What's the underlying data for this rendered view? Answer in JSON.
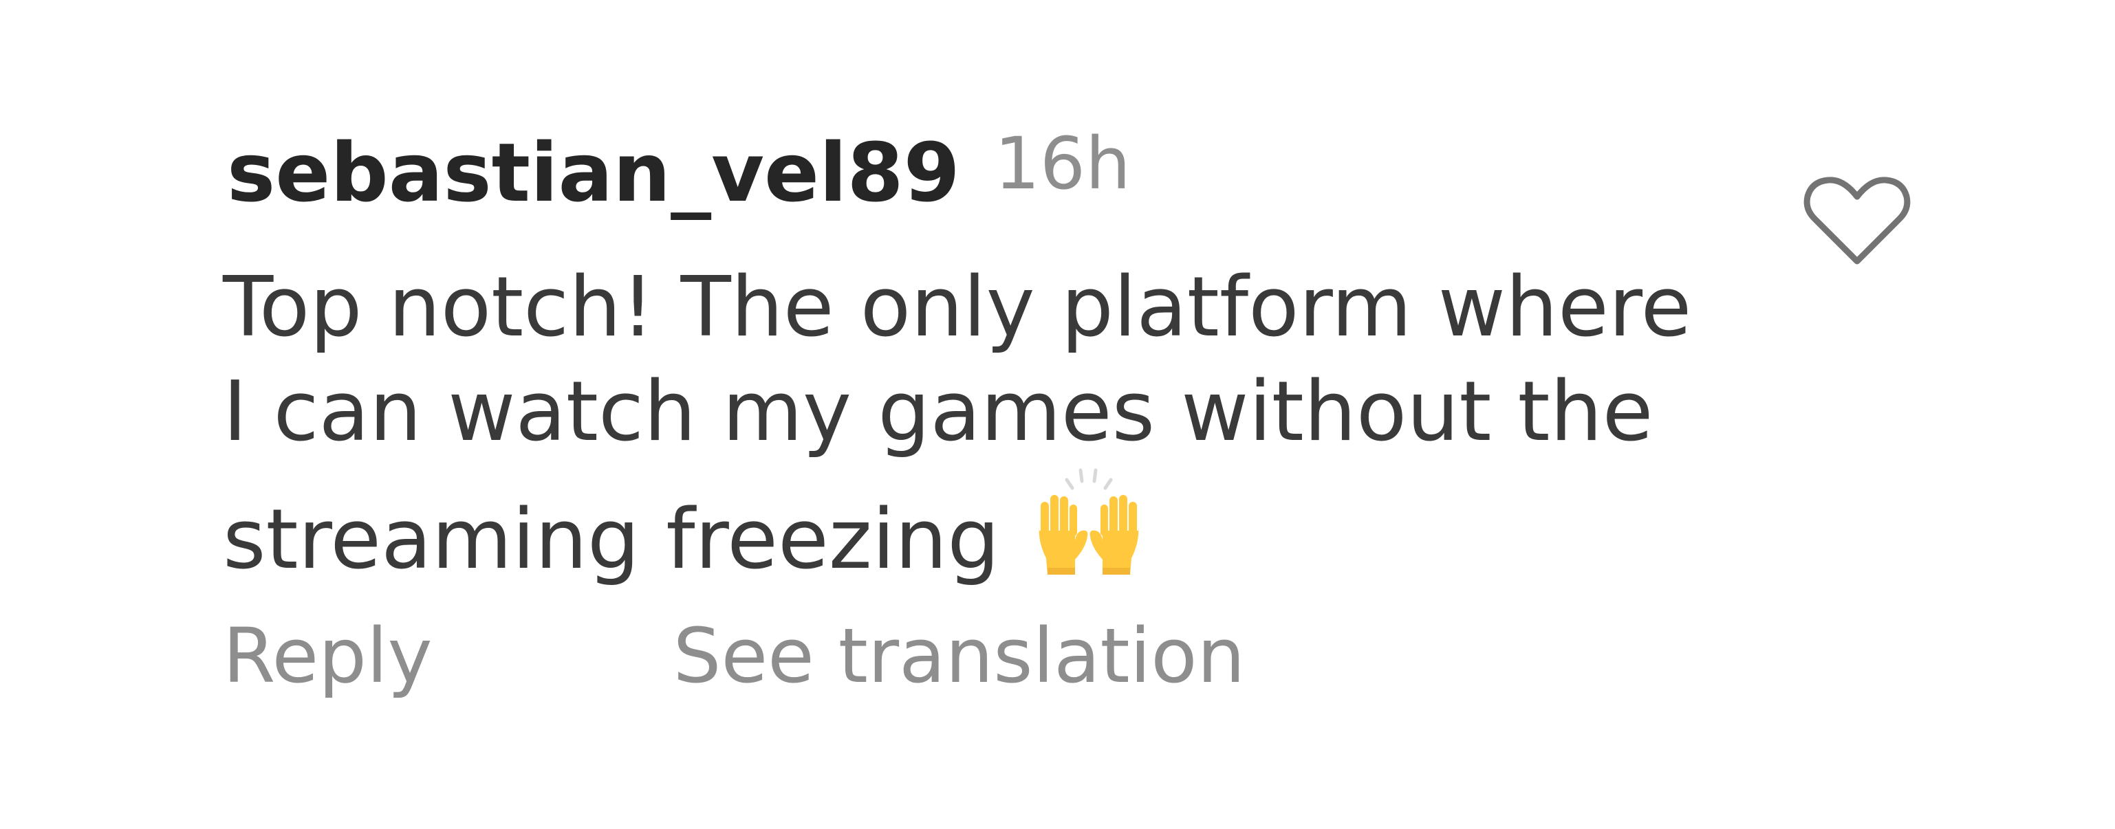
{
  "comment": {
    "username": "sebastian_vel89",
    "timestamp": "16h",
    "text_lines": [
      "Top notch! The only platform where",
      "I can watch my games without the",
      "streaming freezing"
    ],
    "emoji": "raising-hands",
    "actions": {
      "reply_label": "Reply",
      "translate_label": "See translation"
    },
    "like_icon": "heart-outline-icon",
    "liked": false
  },
  "colors": {
    "username": "#262626",
    "body_text": "#3a3a3a",
    "secondary_text": "#8e8e8e",
    "icon_stroke": "#737373",
    "emoji_fill": "#FFC83D"
  }
}
